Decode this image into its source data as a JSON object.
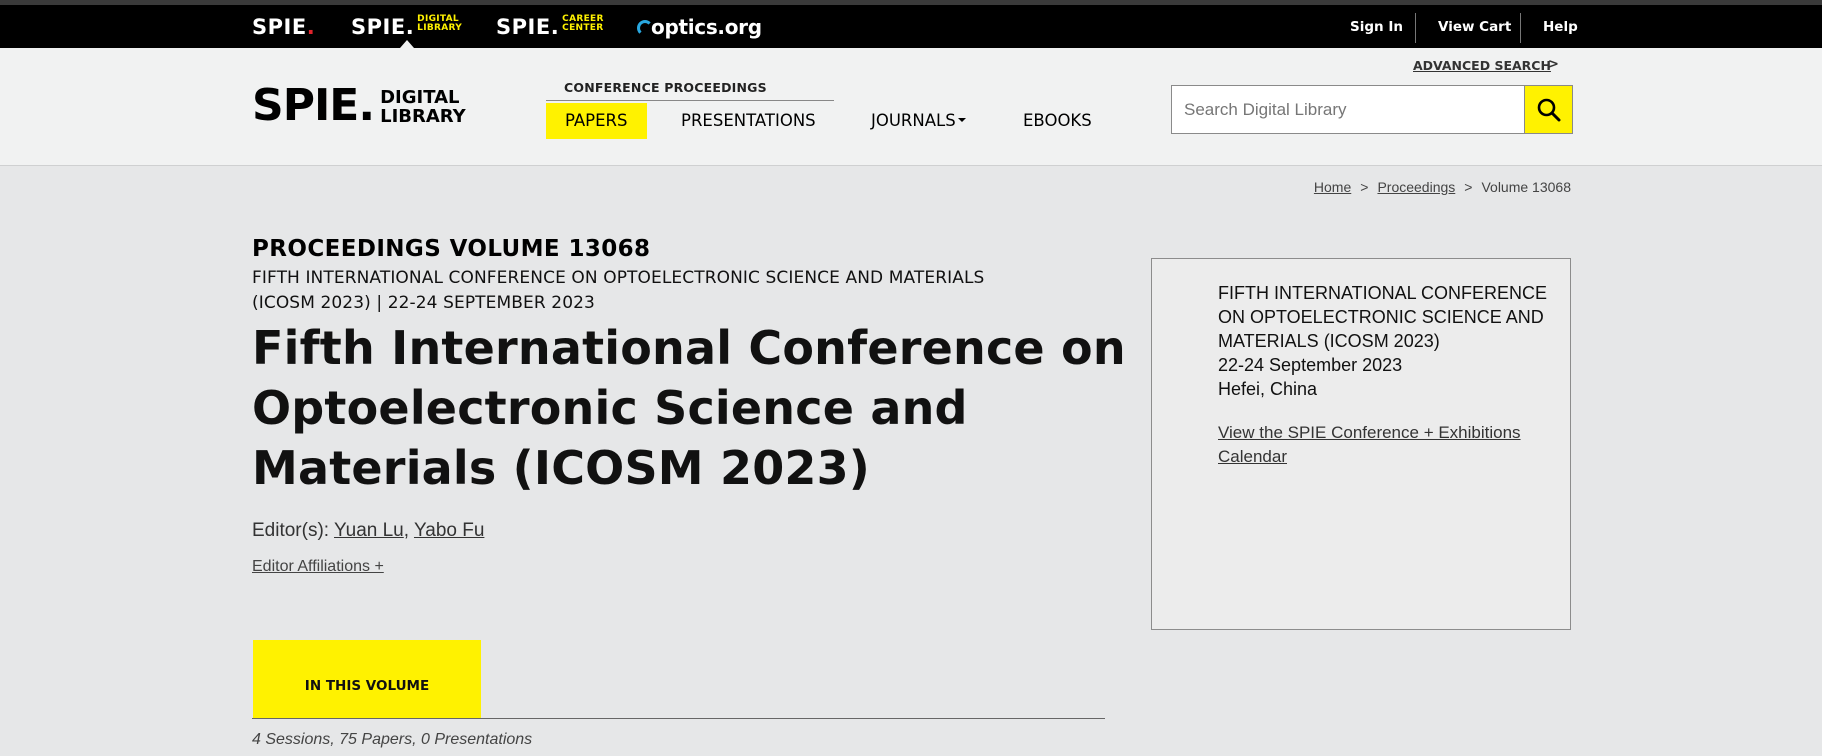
{
  "topbar": {
    "brands": [
      {
        "name": "SPIE",
        "suffix": ""
      },
      {
        "name": "SPIE",
        "suffix_line1": "DIGITAL",
        "suffix_line2": "LIBRARY"
      },
      {
        "name": "SPIE",
        "suffix_line1": "CAREER",
        "suffix_line2": "CENTER"
      },
      {
        "name": "optics.org"
      }
    ],
    "links": {
      "sign_in": "Sign In",
      "view_cart": "View Cart",
      "help": "Help"
    }
  },
  "header": {
    "logo_main": "SPIE",
    "logo_line1": "DIGITAL",
    "logo_line2": "LIBRARY",
    "conference_proceedings": "CONFERENCE PROCEEDINGS",
    "nav": {
      "papers": "PAPERS",
      "presentations": "PRESENTATIONS",
      "journals": "JOURNALS",
      "ebooks": "EBOOKS"
    },
    "advanced_search": "ADVANCED SEARCH",
    "advanced_arrow": ">",
    "search_placeholder": "Search Digital Library"
  },
  "breadcrumb": {
    "home": "Home",
    "proceedings": "Proceedings",
    "current": "Volume 13068",
    "sep": ">"
  },
  "main": {
    "volume_label": "PROCEEDINGS VOLUME 13068",
    "conference_line1": "FIFTH INTERNATIONAL CONFERENCE ON OPTOELECTRONIC SCIENCE AND MATERIALS",
    "conference_line2": "(ICOSM 2023) | 22-24 SEPTEMBER 2023",
    "title_line1": "Fifth International Conference on",
    "title_line2": "Optoelectronic Science and",
    "title_line3": "Materials (ICOSM 2023)",
    "editors_label": "Editor(s):",
    "editor1": "Yuan Lu",
    "editor_sep": ",",
    "editor2": "Yabo Fu",
    "editor_affiliations": "Editor Affiliations +",
    "tab_label": "IN THIS VOLUME",
    "counts": "4 Sessions, 75 Papers, 0 Presentations"
  },
  "infobox": {
    "line1": "FIFTH INTERNATIONAL CONFERENCE",
    "line2": "ON OPTOELECTRONIC SCIENCE AND",
    "line3": "MATERIALS (ICOSM 2023)",
    "dates": "22-24 September 2023",
    "location": "Hefei, China",
    "calendar_link": "View the SPIE Conference + Exhibitions Calendar"
  },
  "colors": {
    "accent": "#fff200",
    "topbar": "#000000",
    "header_bg": "#f1f2f2",
    "page_bg": "#e6e7e8"
  },
  "icons": [
    "search-icon",
    "chevron-down-icon"
  ]
}
